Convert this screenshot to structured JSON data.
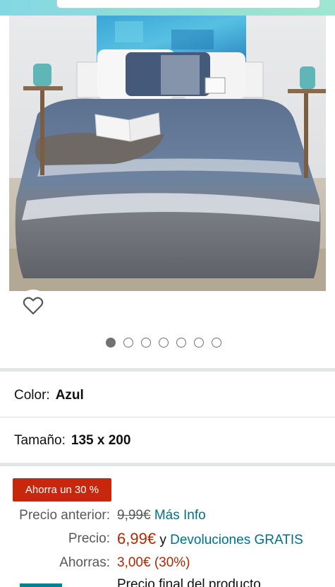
{
  "colors": {
    "accent_teal": "#84d8e3",
    "deal_badge": "#c7270c",
    "price_red": "#b12704",
    "link": "#007185",
    "dot_active": "#6f7373"
  },
  "carousel": {
    "total_images": 7,
    "active_index": 0
  },
  "icons": {
    "wishlist": "heart-outline-icon"
  },
  "variations": {
    "color": {
      "label": "Color:",
      "value": "Azul"
    },
    "size": {
      "label": "Tamaño:",
      "value": "135 x 200"
    }
  },
  "pricing": {
    "deal_badge": "Ahorra un 30 %",
    "previous_label": "Precio anterior:",
    "previous_value": "9,99€",
    "more_info": "Más Info",
    "price_label": "Precio:",
    "price_value": "6,99€",
    "price_connector": "y",
    "returns_link": "Devoluciones GRATIS",
    "savings_label": "Ahorras:",
    "savings_value": "3,00€ (30%)",
    "final_note": "Precio final del producto"
  }
}
